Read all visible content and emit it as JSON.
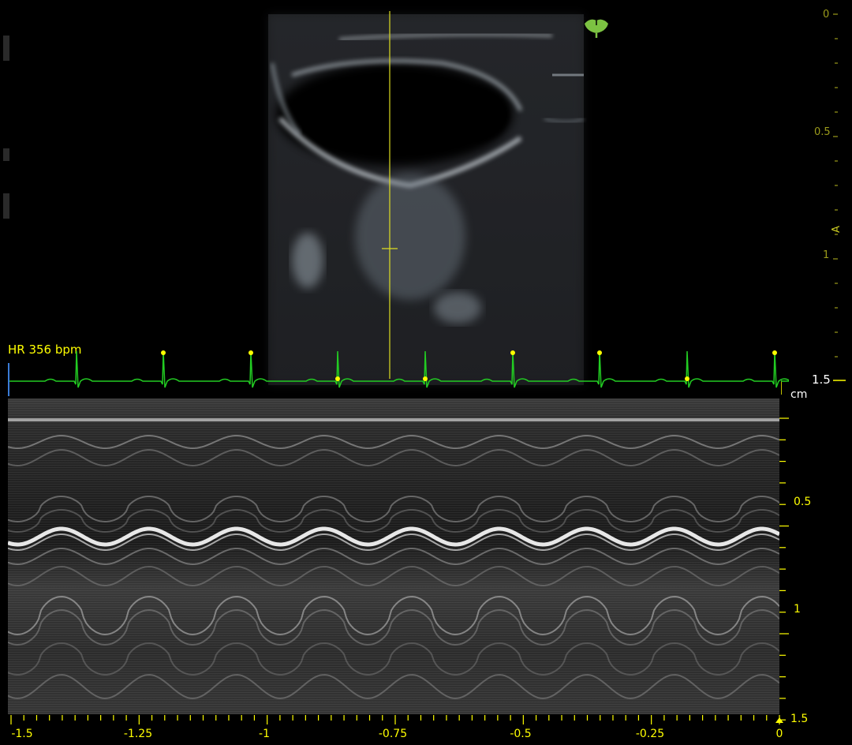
{
  "hr_label": "HR 356 bpm",
  "unit_label": "cm",
  "probe_marker_label": "A",
  "bmode_depth_labels": [
    "0",
    "0.5",
    "1",
    "1.5"
  ],
  "mmode_depth_labels": [
    "0.5",
    "1",
    "1.5"
  ],
  "time_labels": [
    "-1.5",
    "-1.25",
    "-1",
    "-0.75",
    "-0.5",
    "-0.25",
    "0"
  ],
  "colors": {
    "accent": "#ffff00",
    "ecg": "#22cc22",
    "bmode_axis": "#9b9b1a",
    "logo": "#7cc242"
  },
  "icons": {
    "logo": "ginkgo-leaf-icon",
    "time_cursor": "triangle-up-icon"
  }
}
